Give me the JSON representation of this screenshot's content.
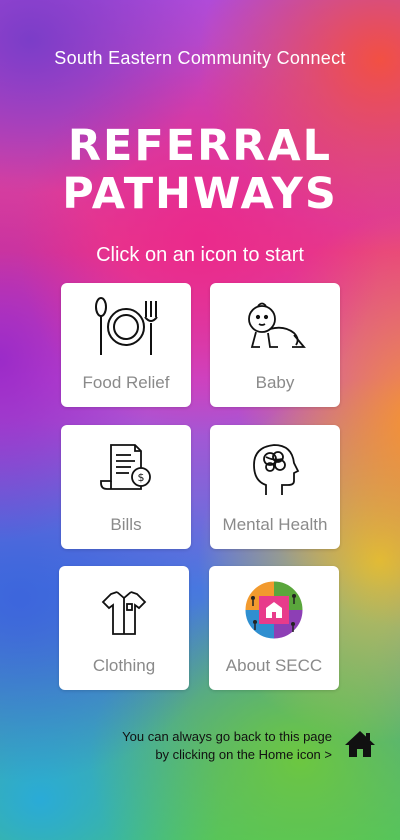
{
  "header": {
    "organization": "South Eastern Community Connect",
    "title_line1": "REFERRAL",
    "title_line2": "PATHWAYS",
    "instruction": "Click on an icon to start"
  },
  "tiles": [
    {
      "label": "Food Relief",
      "icon": "plate-cutlery-icon"
    },
    {
      "label": "Baby",
      "icon": "baby-icon"
    },
    {
      "label": "Bills",
      "icon": "bill-icon"
    },
    {
      "label": "Mental Health",
      "icon": "brain-head-icon"
    },
    {
      "label": "Clothing",
      "icon": "shirt-icon"
    },
    {
      "label": "About SECC",
      "icon": "secc-logo-icon"
    }
  ],
  "footer": {
    "line1": "You can always go back to this page",
    "line2": "by clicking on the Home icon >",
    "home_icon": "home-icon"
  },
  "colors": {
    "tile_background": "#ffffff",
    "tile_label": "#8a8a8a",
    "heading_text": "#ffffff"
  }
}
